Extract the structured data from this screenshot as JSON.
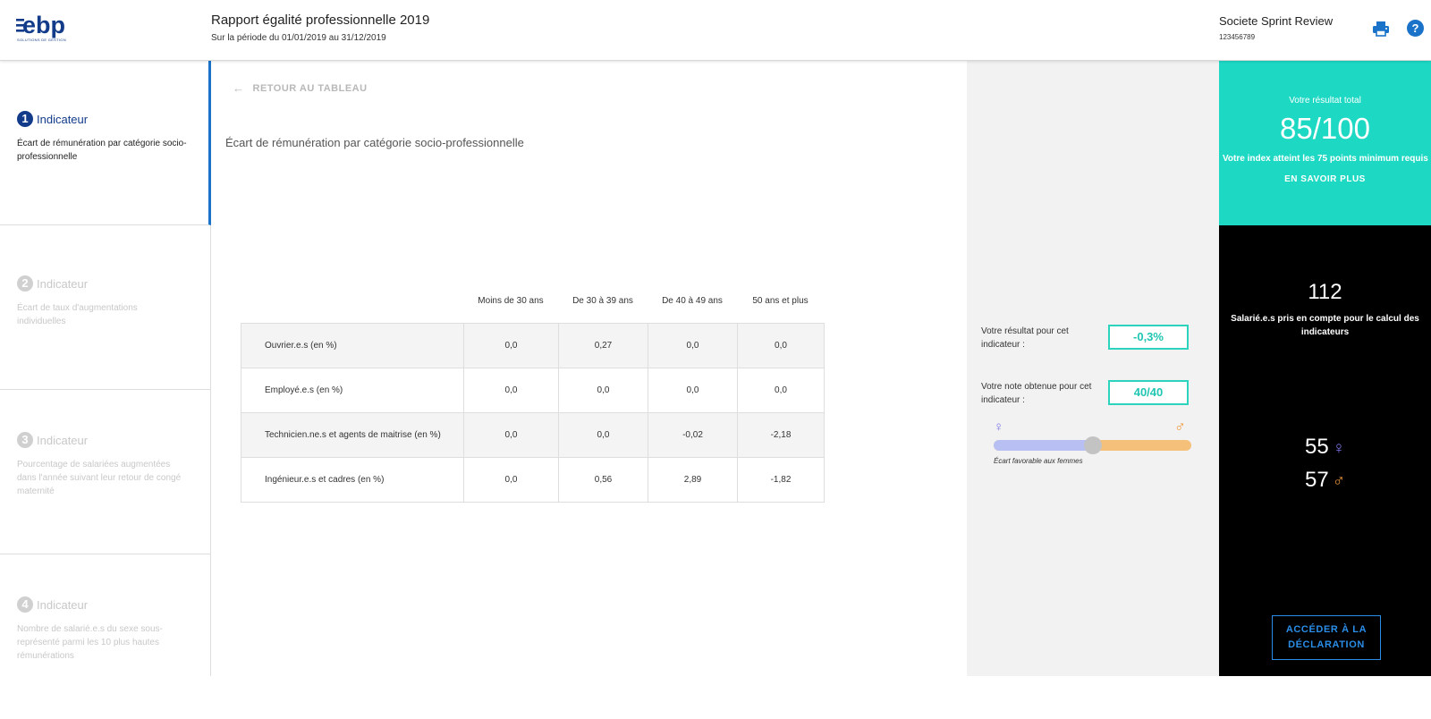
{
  "header": {
    "logo_text": "ebp",
    "logo_tagline": "SOLUTIONS DE GESTION",
    "title": "Rapport égalité professionnelle 2019",
    "period": "Sur la période du 01/01/2019 au 31/12/2019",
    "company": "Societe Sprint Review",
    "company_id": "123456789",
    "print_icon": "printer-icon",
    "help_icon": "help-icon",
    "help_glyph": "?"
  },
  "sidebar": {
    "steps": [
      {
        "number": "1",
        "label": "Indicateur",
        "desc": "Écart de rémunération par catégorie socio-professionnelle",
        "active": true
      },
      {
        "number": "2",
        "label": "Indicateur",
        "desc": "Écart de taux d'augmentations individuelles",
        "active": false
      },
      {
        "number": "3",
        "label": "Indicateur",
        "desc": "Pourcentage de salariées augmentées dans l'année suivant leur retour de congé maternité",
        "active": false
      },
      {
        "number": "4",
        "label": "Indicateur",
        "desc": "Nombre de salarié.e.s du sexe sous-représenté parmi les 10 plus hautes rémunérations",
        "active": false
      }
    ]
  },
  "main": {
    "back_arrow": "←",
    "back_label": "RETOUR AU TABLEAU",
    "title": "Écart de rémunération par catégorie socio-professionnelle",
    "columns": [
      "Moins de 30 ans",
      "De 30 à 39 ans",
      "De 40 à 49 ans",
      "50 ans et plus"
    ],
    "rows": [
      {
        "label": "Ouvrier.e.s (en %)",
        "values": [
          "0,0",
          "0,27",
          "0,0",
          "0,0"
        ]
      },
      {
        "label": "Employé.e.s (en %)",
        "values": [
          "0,0",
          "0,0",
          "0,0",
          "0,0"
        ]
      },
      {
        "label": "Technicien.ne.s et agents de maitrise (en %)",
        "values": [
          "0,0",
          "0,0",
          "-0,02",
          "-2,18"
        ]
      },
      {
        "label": "Ingénieur.e.s et cadres (en %)",
        "values": [
          "0,0",
          "0,56",
          "2,89",
          "-1,82"
        ]
      }
    ]
  },
  "result_panel": {
    "result_label": "Votre résultat pour cet indicateur :",
    "result_value": "-0,3%",
    "note_label": "Votre note obtenue pour cet indicateur :",
    "note_value": "40/40",
    "female_symbol": "♀",
    "male_symbol": "♂",
    "slider_position": 0.5,
    "slider_caption": "Écart favorable aux femmes",
    "colors": {
      "female": "#7d75e8",
      "male": "#f09a3a",
      "accent": "#2dd4bd"
    }
  },
  "score_panel": {
    "caption": "Votre résultat total",
    "score": "85/100",
    "message": "Votre index atteint les 75 points minimum requis",
    "learn_more": "EN SAVOIR PLUS",
    "employees": "112",
    "employees_label": "Salarié.e.s pris en compte pour le calcul des indicateurs",
    "women": "55",
    "men": "57",
    "declare_button": "ACCÉDER À LA DÉCLARATION",
    "colors": {
      "top": "#1dd9c4",
      "background": "#000000",
      "button": "#2a8de8"
    }
  }
}
